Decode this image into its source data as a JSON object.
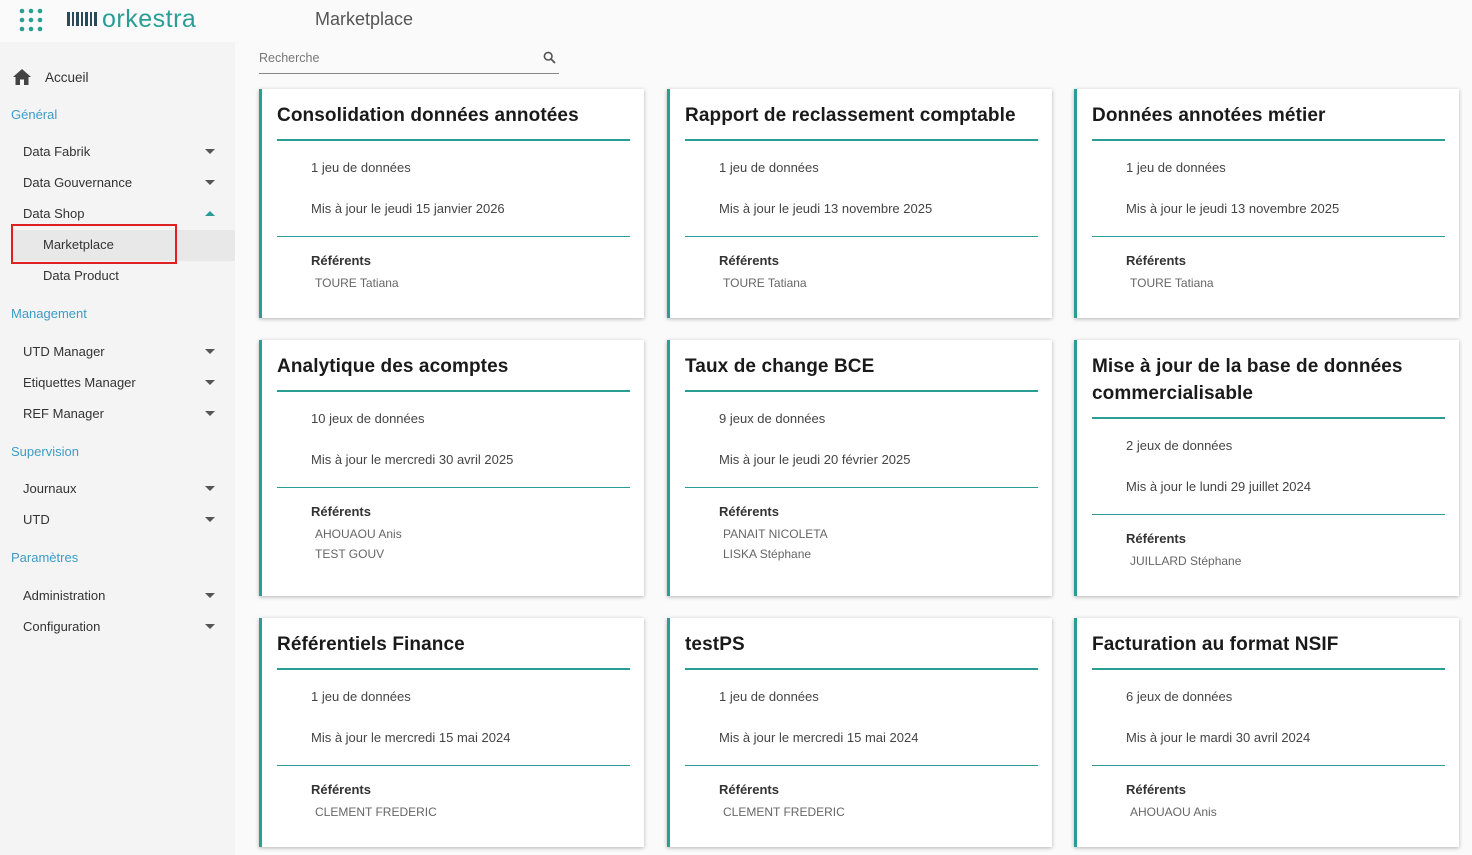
{
  "app": {
    "logo_text": "orkestra",
    "page_title": "Marketplace"
  },
  "search": {
    "placeholder": "Recherche",
    "value": ""
  },
  "sidebar": {
    "home_label": "Accueil",
    "sections": {
      "general": "Général",
      "management": "Management",
      "supervision": "Supervision",
      "parametres": "Paramètres"
    },
    "items": {
      "data_fabrik": "Data Fabrik",
      "data_gouvernance": "Data Gouvernance",
      "data_shop": "Data Shop",
      "marketplace": "Marketplace",
      "data_product": "Data Product",
      "utd_manager": "UTD Manager",
      "etiquettes_manager": "Etiquettes Manager",
      "ref_manager": "REF Manager",
      "journaux": "Journaux",
      "utd": "UTD",
      "administration": "Administration",
      "configuration": "Configuration"
    },
    "active_item": "Marketplace"
  },
  "cards": [
    {
      "title": "Consolidation données annotées",
      "count": "1 jeu de données",
      "updated": "Mis à jour le jeudi 15 janvier 2026",
      "referents_label": "Référents",
      "referents": [
        "TOURE Tatiana"
      ]
    },
    {
      "title": "Rapport de reclassement comptable",
      "count": "1 jeu de données",
      "updated": "Mis à jour le jeudi 13 novembre 2025",
      "referents_label": "Référents",
      "referents": [
        "TOURE Tatiana"
      ]
    },
    {
      "title": "Données annotées métier",
      "count": "1 jeu de données",
      "updated": "Mis à jour le jeudi 13 novembre 2025",
      "referents_label": "Référents",
      "referents": [
        "TOURE Tatiana"
      ]
    },
    {
      "title": "Analytique des acomptes",
      "count": "10 jeux de données",
      "updated": "Mis à jour le mercredi 30 avril 2025",
      "referents_label": "Référents",
      "referents": [
        "AHOUAOU Anis",
        "TEST GOUV"
      ]
    },
    {
      "title": "Taux de change BCE",
      "count": "9 jeux de données",
      "updated": "Mis à jour le jeudi 20 février 2025",
      "referents_label": "Référents",
      "referents": [
        "PANAIT NICOLETA",
        "LISKA Stéphane"
      ]
    },
    {
      "title": "Mise à jour de la base de données commercialisable",
      "count": "2 jeux de données",
      "updated": "Mis à jour le lundi 29 juillet 2024",
      "referents_label": "Référents",
      "referents": [
        "JUILLARD Stéphane"
      ]
    },
    {
      "title": "Référentiels Finance",
      "count": "1 jeu de données",
      "updated": "Mis à jour le mercredi 15 mai 2024",
      "referents_label": "Référents",
      "referents": [
        "CLEMENT FREDERIC"
      ]
    },
    {
      "title": "testPS",
      "count": "1 jeu de données",
      "updated": "Mis à jour le mercredi 15 mai 2024",
      "referents_label": "Référents",
      "referents": [
        "CLEMENT FREDERIC"
      ]
    },
    {
      "title": "Facturation au format NSIF",
      "count": "6 jeux de données",
      "updated": "Mis à jour le mardi 30 avril 2024",
      "referents_label": "Référents",
      "referents": [
        "AHOUAOU Anis"
      ]
    }
  ],
  "colors": {
    "accent": "#2a9d95",
    "section": "#3c9cc7",
    "highlight": "#e02020"
  }
}
